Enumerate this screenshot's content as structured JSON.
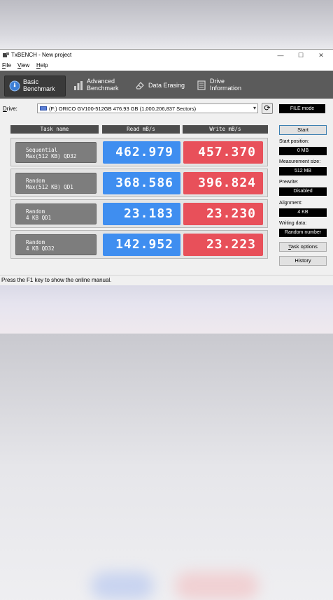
{
  "window": {
    "title": "TxBENCH - New project",
    "controls": {
      "minimize": "—",
      "maximize": "☐",
      "close": "✕"
    }
  },
  "menu": {
    "file": {
      "u": "F",
      "rest": "ile"
    },
    "view": {
      "u": "V",
      "rest": "iew"
    },
    "help": {
      "u": "H",
      "rest": "elp"
    }
  },
  "tabs": [
    {
      "line1": "Basic",
      "line2": "Benchmark",
      "icon": "speedometer-icon",
      "active": true
    },
    {
      "line1": "Advanced",
      "line2": "Benchmark",
      "icon": "bar-chart-icon",
      "active": false
    },
    {
      "line1": "Data Erasing",
      "icon": "eraser-icon",
      "active": false
    },
    {
      "line1": "Drive",
      "line2": "Information",
      "icon": "drive-info-icon",
      "active": false
    }
  ],
  "drive": {
    "label_u": "D",
    "label_rest": "rive:",
    "selected": "(F:) ORICO GV100-512GB  476.93 GB (1,000,206,837 Sectors)",
    "mode": "FILE mode"
  },
  "results": {
    "headers": {
      "task": "Task name",
      "read": "Read mB/s",
      "write": "Write mB/s"
    },
    "rows": [
      {
        "task": "Sequential\nMax(512 KB) QD32",
        "read": "462.979",
        "write": "457.370"
      },
      {
        "task": "Random\nMax(512 KB) QD1",
        "read": "368.586",
        "write": "396.824"
      },
      {
        "task": "Random\n4 KB QD1",
        "read": "23.183",
        "write": "23.230"
      },
      {
        "task": "Random\n4 KB QD32",
        "read": "142.952",
        "write": "23.223"
      }
    ]
  },
  "side": {
    "start": "Start",
    "start_position_label": "Start position:",
    "start_position_value": "0 MB",
    "measurement_size_label": "Measurement size:",
    "measurement_size_value": "512 MB",
    "prewrite_label": "Prewrite:",
    "prewrite_value": "Disabled",
    "alignment_label": "Alignment:",
    "alignment_value": "4 KB",
    "writing_data_label": "Writing data:",
    "writing_data_value": "Random number",
    "task_options_u": "T",
    "task_options_rest": "ask options",
    "history": "History"
  },
  "status": "Press the F1 key to show the online manual.",
  "colors": {
    "read": "#3f8ef0",
    "write": "#e8505a",
    "tabbar": "#5b5b5b"
  }
}
